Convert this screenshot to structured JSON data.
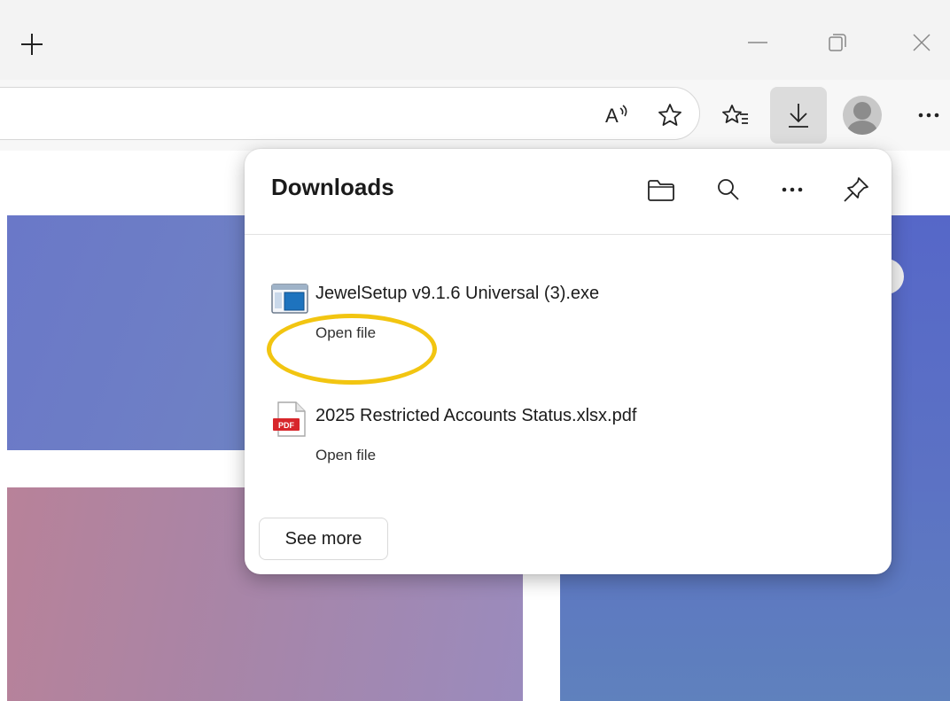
{
  "titlebar": {
    "new_tab_icon": "plus-icon",
    "window_controls": [
      "minimize-icon",
      "restore-icon",
      "close-icon"
    ]
  },
  "toolbar": {
    "icons": [
      "read-aloud-icon",
      "favorite-star-icon",
      "favorites-list-icon",
      "download-icon",
      "profile-avatar-icon",
      "more-options-icon"
    ],
    "read_aloud_label": "A⁾"
  },
  "downloads": {
    "title": "Downloads",
    "header_icons": [
      "folder-icon",
      "search-icon",
      "more-icon",
      "pin-icon"
    ],
    "items": [
      {
        "filename": "JewelSetup v9.1.6 Universal (3).exe",
        "action": "Open file",
        "icon": "exe-file-icon"
      },
      {
        "filename": "2025 Restricted Accounts Status.xlsx.pdf",
        "action": "Open file",
        "icon": "pdf-file-icon",
        "icon_label": "PDF"
      }
    ],
    "see_more_label": "See more"
  },
  "colors": {
    "highlight_ring": "#f2c511",
    "pdf_red": "#d7262b",
    "exe_blue": "#1e73be"
  }
}
